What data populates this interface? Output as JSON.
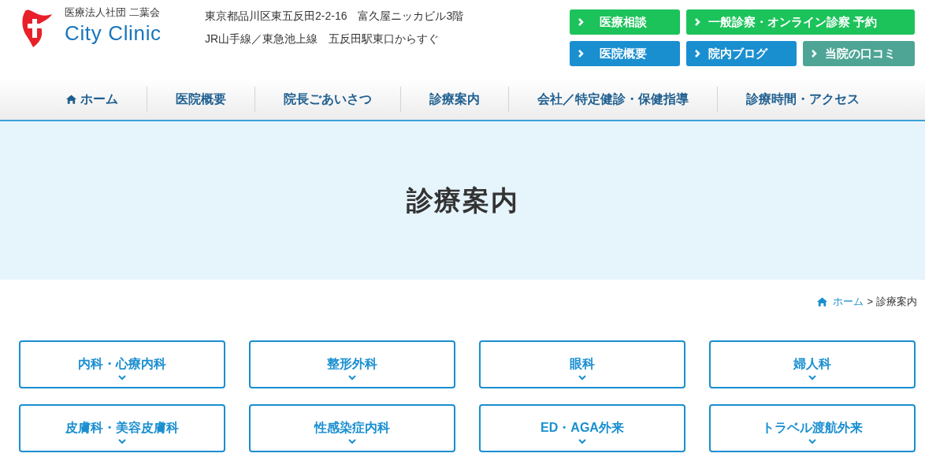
{
  "header": {
    "org": "医療法人社団 二葉会",
    "logo_text": "City Clinic",
    "address": "東京都品川区東五反田2-2-16　富久屋ニッカビル3階",
    "access": "JR山手線／東急池上線　五反田駅東口からすぐ",
    "buttons": [
      {
        "label": "医療相談",
        "color": "#1cc35a"
      },
      {
        "label": "一般診察・オンライン診察 予約",
        "color": "#1cc35a"
      },
      {
        "label": "医院概要",
        "color": "#1a8fd0"
      },
      {
        "label": "院内ブログ",
        "color": "#1a8fd0"
      },
      {
        "label": "当院の口コミ",
        "color": "#4ea595"
      }
    ]
  },
  "nav": [
    {
      "label": "ホーム",
      "kind": "home"
    },
    {
      "label": "医院概要",
      "kind": "plain"
    },
    {
      "label": "院長ごあいさつ",
      "kind": "plain"
    },
    {
      "label": "診療案内",
      "kind": "plain"
    },
    {
      "label": "会社／特定健診・保健指導",
      "kind": "plain"
    },
    {
      "label": "診療時間・アクセス",
      "kind": "plain"
    }
  ],
  "hero": {
    "title": "診療案内"
  },
  "breadcrumb": {
    "home": "ホーム",
    "separator": ">",
    "current": "診療案内"
  },
  "departments": [
    "内科・心療内科",
    "整形外科",
    "眼科",
    "婦人科",
    "皮膚科・美容皮膚科",
    "性感染症内科",
    "ED・AGA外来",
    "トラベル渡航外来"
  ]
}
